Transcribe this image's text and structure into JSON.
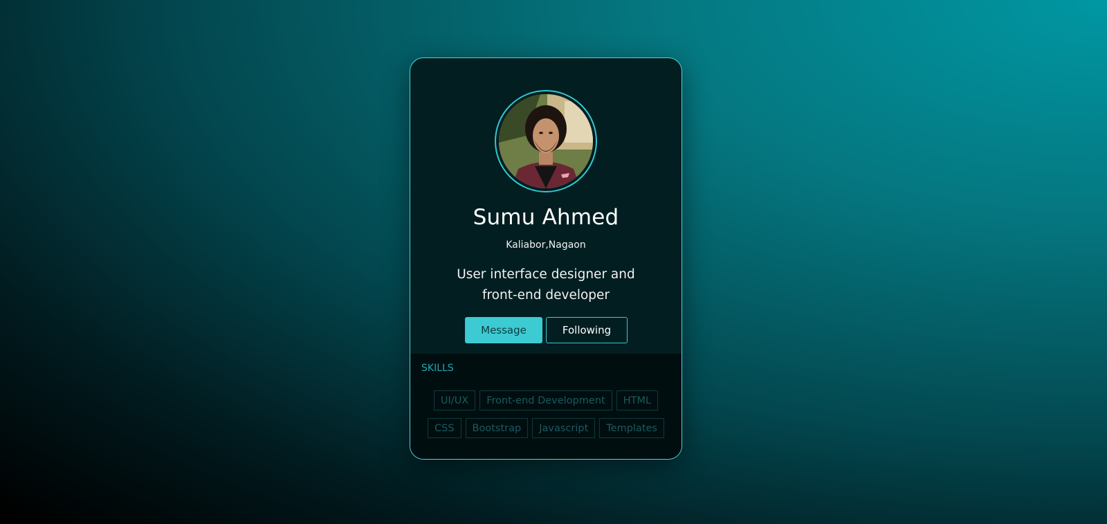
{
  "profile": {
    "name": "Sumu Ahmed",
    "location": "Kaliabor,Nagaon",
    "bio_line1": "User interface designer and",
    "bio_line2": "front-end developer"
  },
  "actions": {
    "message_label": "Message",
    "following_label": "Following"
  },
  "skills": {
    "title": "SKILLS",
    "row1": [
      "UI/UX",
      "Front-end Development",
      "HTML"
    ],
    "row2": [
      "CSS",
      "Bootstrap",
      "Javascript",
      "Templates"
    ]
  },
  "colors": {
    "accent": "#3ccbd3",
    "card_background": "#021e21",
    "skills_background": "#010e10"
  }
}
